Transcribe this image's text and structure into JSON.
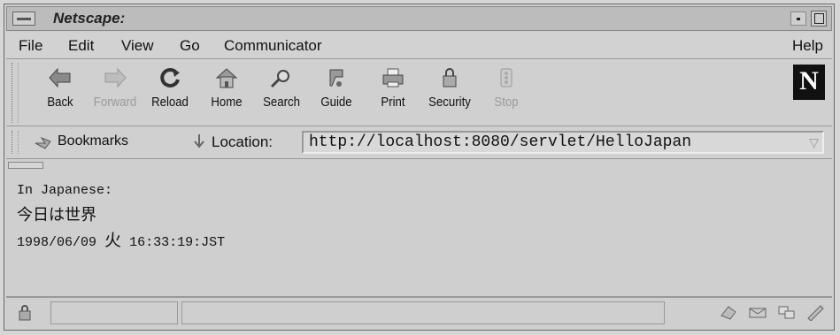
{
  "window": {
    "title": "Netscape:"
  },
  "menubar": {
    "items": [
      "File",
      "Edit",
      "View",
      "Go",
      "Communicator"
    ],
    "help": "Help"
  },
  "toolbar": {
    "buttons": [
      {
        "label": "Back",
        "icon": "back-arrow-icon",
        "enabled": true
      },
      {
        "label": "Forward",
        "icon": "forward-arrow-icon",
        "enabled": false
      },
      {
        "label": "Reload",
        "icon": "reload-icon",
        "enabled": true
      },
      {
        "label": "Home",
        "icon": "home-icon",
        "enabled": true
      },
      {
        "label": "Search",
        "icon": "search-icon",
        "enabled": true
      },
      {
        "label": "Guide",
        "icon": "guide-icon",
        "enabled": true
      },
      {
        "label": "Print",
        "icon": "print-icon",
        "enabled": true
      },
      {
        "label": "Security",
        "icon": "security-lock-icon",
        "enabled": true
      },
      {
        "label": "Stop",
        "icon": "stop-icon",
        "enabled": false
      }
    ],
    "logo": "N"
  },
  "location_bar": {
    "bookmarks_label": "Bookmarks",
    "location_label": "Location:",
    "url": "http://localhost:8080/servlet/HelloJapan"
  },
  "content": {
    "line1": "In Japanese:",
    "line2": "今日は世界",
    "line3_date": "1998/06/09",
    "line3_day": "火",
    "line3_time": "16:33:19:JST"
  },
  "colors": {
    "chrome": "#d0d0d0",
    "text": "#111111",
    "disabled": "#9a9a9a"
  }
}
